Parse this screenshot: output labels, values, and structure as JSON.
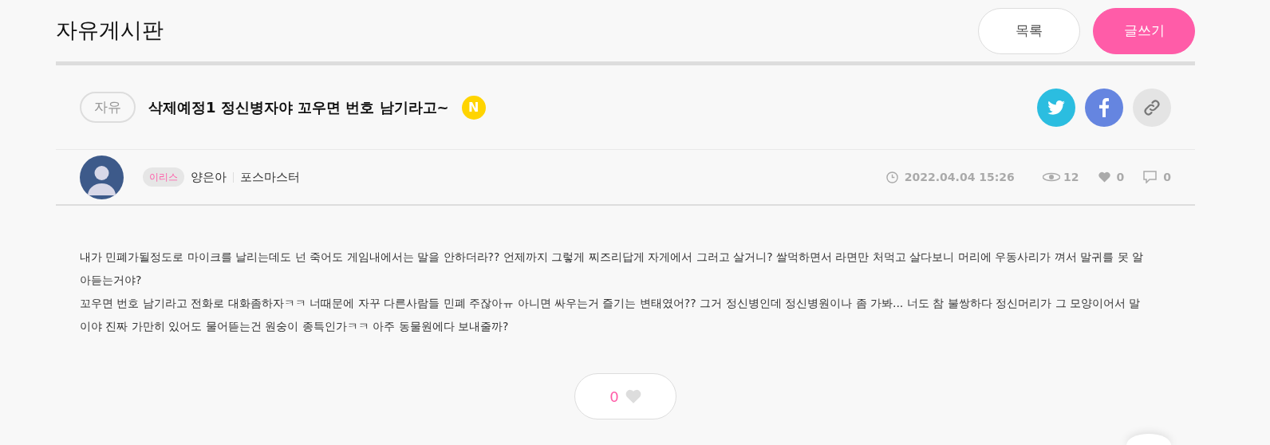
{
  "board": {
    "title": "자유게시판"
  },
  "header_buttons": [
    {
      "label": "목록",
      "kind": "outline"
    },
    {
      "label": "글쓰기",
      "kind": "primary"
    }
  ],
  "post": {
    "category": "자유",
    "title": "삭제예정1 정신병자야 꼬우면 번호 남기라고~",
    "new_badge": "N",
    "share_buttons": [
      {
        "kind": "twitter"
      },
      {
        "kind": "facebook"
      },
      {
        "kind": "link"
      }
    ],
    "author": {
      "badge": "이리스",
      "name": "양은아",
      "server": "포스마스터"
    },
    "stats": {
      "date": "2022.04.04 15:26",
      "views": "12",
      "likes": "0",
      "comments": "0"
    },
    "body": [
      "내가 민폐가될정도로 마이크를 날리는데도 넌 죽어도 게임내에서는 말을 안하더라?? 언제까지 그렇게 찌즈리답게 자게에서 그러고 살거니? 쌀먹하면서 라면만 처먹고 살다보니 머리에 우동사리가 껴서 말귀를 못 알아듣는거야?",
      "꼬우면 번호 남기라고 전화로 대화좀하자ㅋㅋ 너때문에 자꾸 다른사람들 민폐 주잖아ㅠ 아니면 싸우는거 즐기는 변태였어?? 그거 정신병인데 정신병원이나 좀 가봐... 너도 참 불쌍하다 정신머리가 그 모양이어서 말이야 진짜 가만히 있어도 물어뜯는건 원숭이 종특인가ㅋㅋ 아주 동물원에다 보내줄까?"
    ],
    "like_button": {
      "count": "0"
    }
  }
}
